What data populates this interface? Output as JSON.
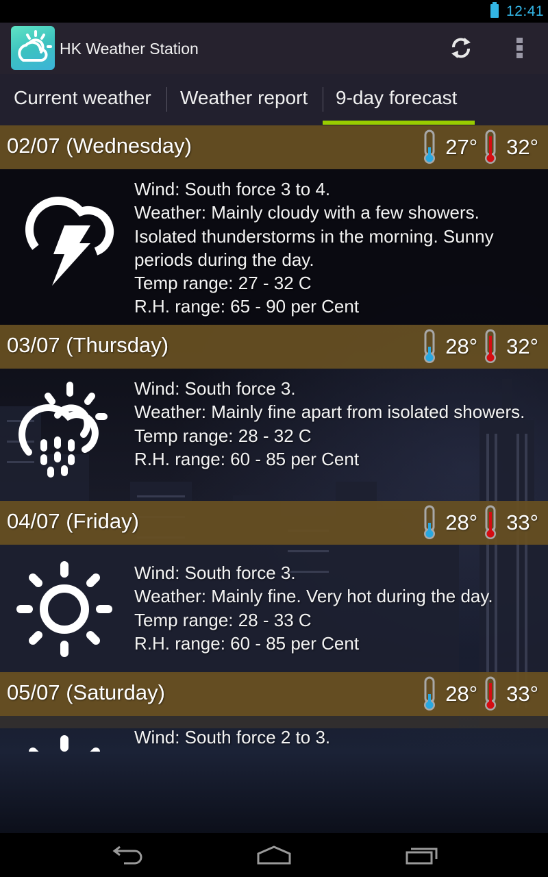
{
  "status_bar": {
    "time": "12:41",
    "battery_icon": "battery-full-icon",
    "accent": "#33b5e5"
  },
  "action_bar": {
    "title": "HK Weather Station",
    "app_icon": "sun-cloud-app-icon",
    "refresh_icon": "refresh-icon",
    "overflow_icon": "overflow-menu-icon"
  },
  "tabs": [
    {
      "label": "Current weather",
      "selected": false
    },
    {
      "label": "Weather report",
      "selected": false
    },
    {
      "label": "9-day forecast",
      "selected": true
    }
  ],
  "colors": {
    "tab_indicator": "#99cc00",
    "day_header": "#685022",
    "thermo_low": "#29a8e0",
    "thermo_high": "#d40d12"
  },
  "forecast": [
    {
      "date": "02/07 (Wednesday)",
      "low": "27°",
      "high": "32°",
      "icon": "thunderstorm-icon",
      "lines": [
        "Wind: South force 3 to 4.",
        "Weather: Mainly cloudy with a few showers. Isolated thunderstorms in the morning. Sunny periods during the day.",
        "Temp range: 27 -  32 C",
        "R.H. range:  65 -  90 per Cent"
      ]
    },
    {
      "date": "03/07 (Thursday)",
      "low": "28°",
      "high": "32°",
      "icon": "sun-cloud-rain-icon",
      "lines": [
        "Wind: South force 3.",
        "Weather: Mainly fine apart from isolated showers.",
        "Temp range: 28 -  32 C",
        "R.H. range:  60 -  85 per Cent"
      ]
    },
    {
      "date": "04/07 (Friday)",
      "low": "28°",
      "high": "33°",
      "icon": "sunny-icon",
      "lines": [
        "Wind: South force 3.",
        "Weather: Mainly fine. Very hot during the day.",
        "Temp range: 28 -  33 C",
        "R.H. range:  60 -  85 per Cent"
      ]
    },
    {
      "date": "05/07 (Saturday)",
      "low": "28°",
      "high": "33°",
      "icon": "sunny-icon",
      "lines": [
        "Wind: South force 2 to 3."
      ]
    }
  ],
  "nav_bar": {
    "back_icon": "back-icon",
    "home_icon": "home-icon",
    "recents_icon": "recent-apps-icon"
  }
}
